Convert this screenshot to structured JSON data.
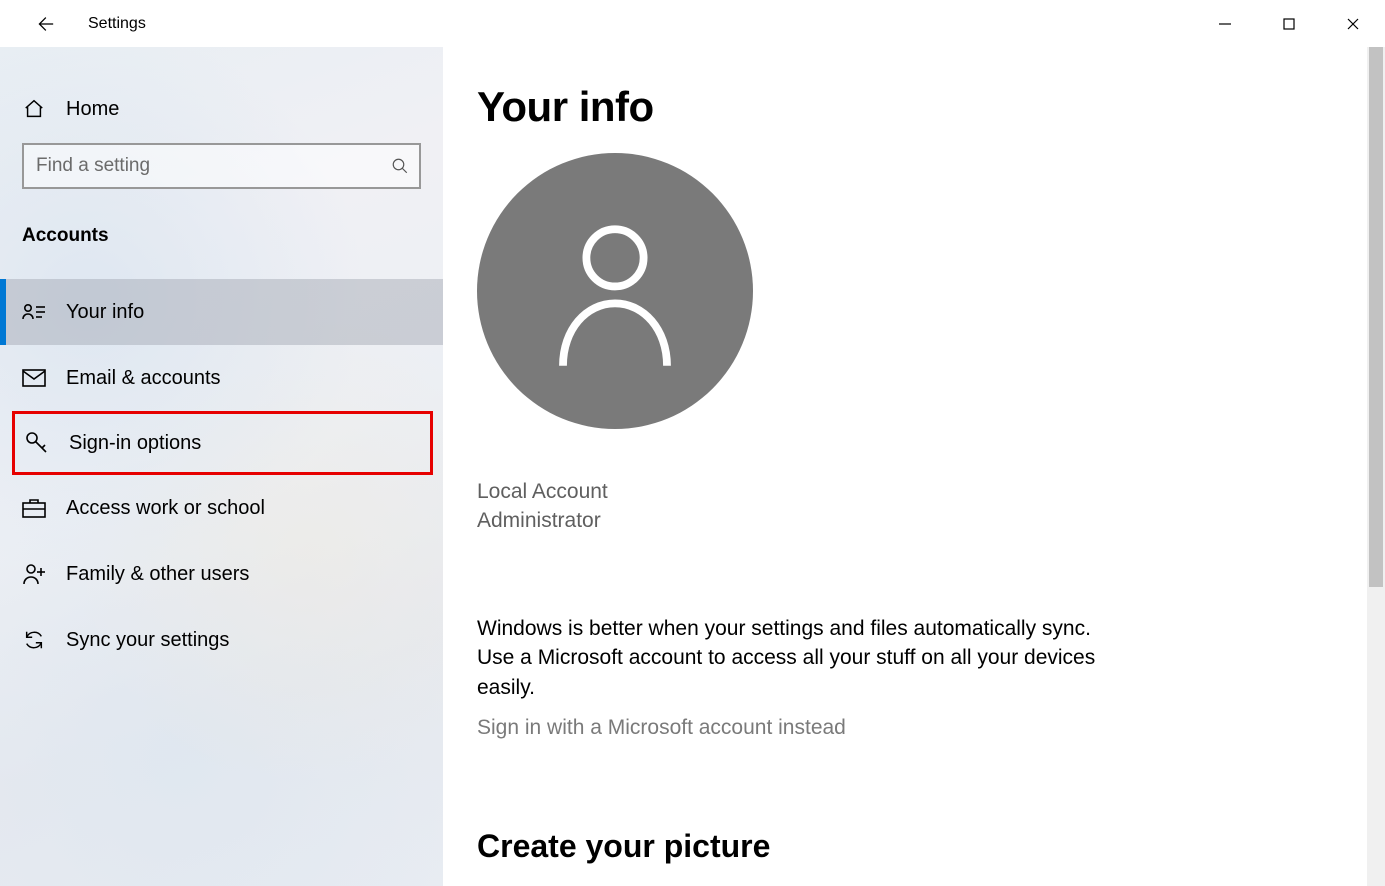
{
  "app": {
    "title": "Settings"
  },
  "sidebar": {
    "home_label": "Home",
    "search_placeholder": "Find a setting",
    "section": "Accounts",
    "items": [
      {
        "label": "Your info"
      },
      {
        "label": "Email & accounts"
      },
      {
        "label": "Sign-in options"
      },
      {
        "label": "Access work or school"
      },
      {
        "label": "Family & other users"
      },
      {
        "label": "Sync your settings"
      }
    ]
  },
  "content": {
    "title": "Your info",
    "account_type": "Local Account",
    "account_role": "Administrator",
    "sync_text": "Windows is better when your settings and files automatically sync. Use a Microsoft account to access all your stuff on all your devices easily.",
    "ms_link": "Sign in with a Microsoft account instead",
    "picture_section": "Create your picture"
  }
}
